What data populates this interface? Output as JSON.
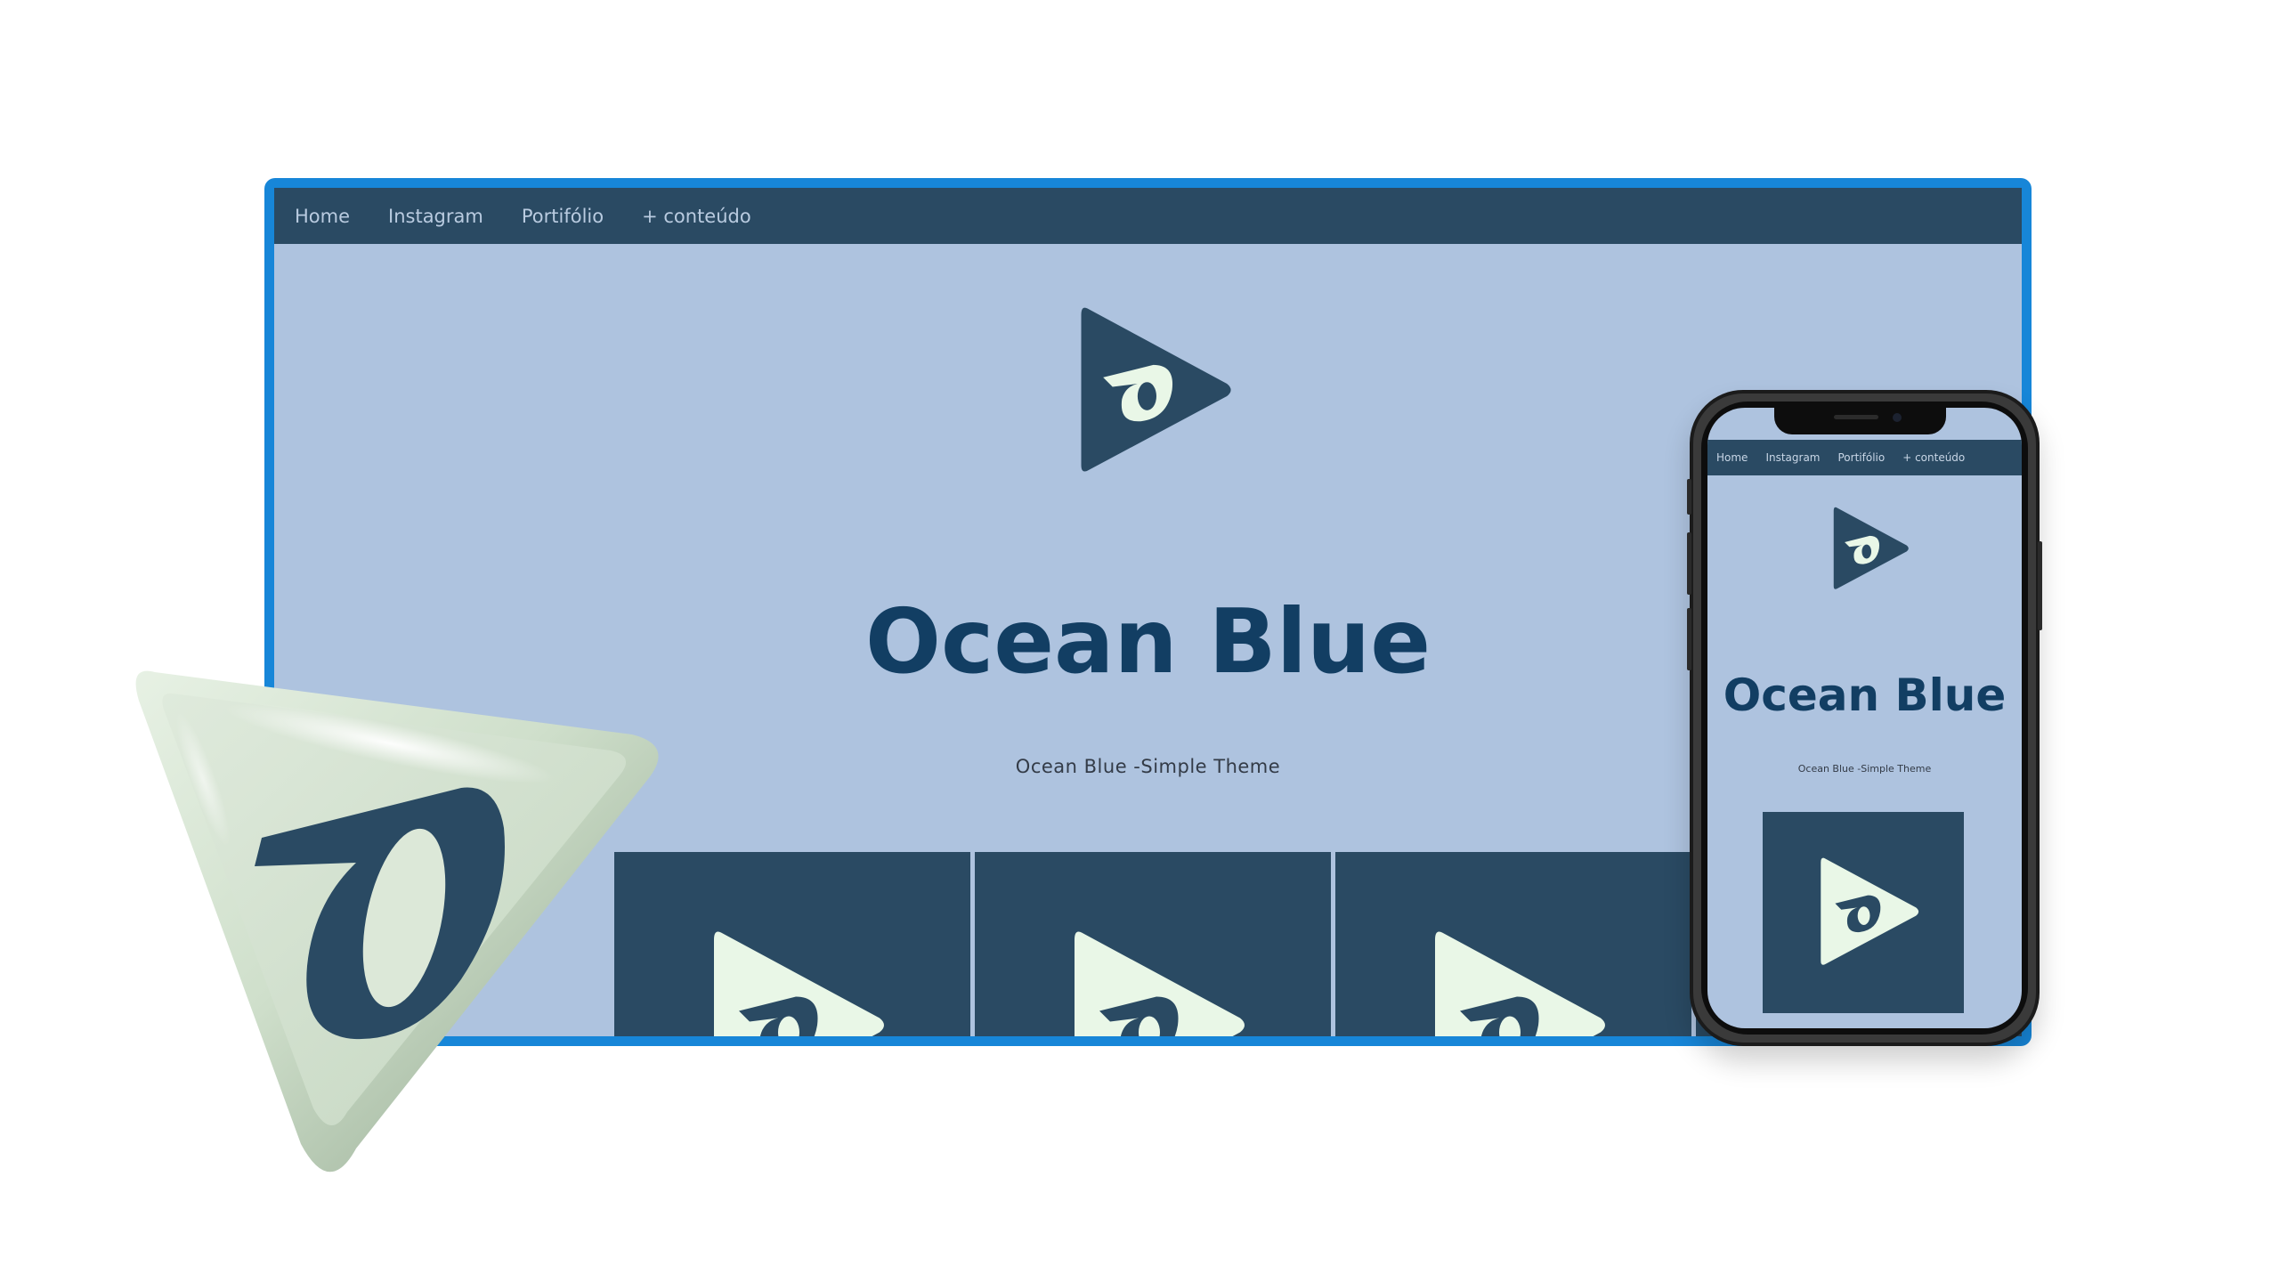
{
  "nav": {
    "items": [
      "Home",
      "Instagram",
      "Portifólio",
      "+ conteúdo"
    ]
  },
  "hero": {
    "title": "Ocean Blue",
    "subtitle": "Ocean Blue -Simple Theme"
  },
  "icons": {
    "brand": "play-triangle-logo-icon",
    "emblem": "3d-triangle-logo-icon"
  },
  "colors": {
    "frame": "#1786d8",
    "nav_bg": "#2a4a63",
    "page_bg": "#aec3df",
    "title": "#123e63",
    "logo_fill": "#2a4a63",
    "tile_logo_fill": "#e9f7e7",
    "emblem_body": "#cfdfcb",
    "emblem_mark": "#2a4a63"
  }
}
